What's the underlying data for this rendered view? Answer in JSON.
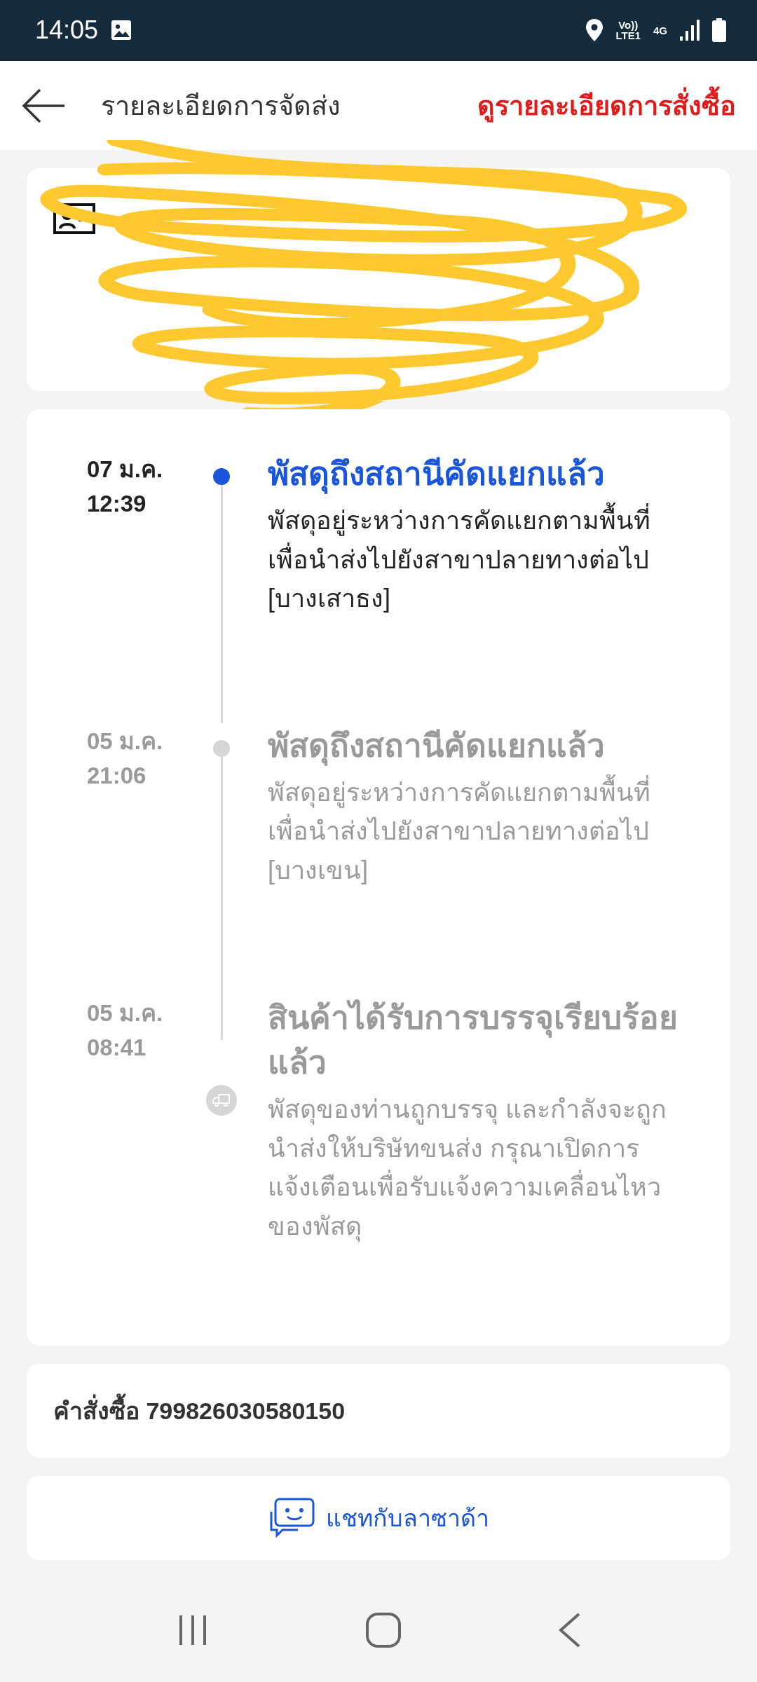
{
  "status_bar": {
    "time": "14:05",
    "network_label": "Vo)) LTE1",
    "network_type": "4G"
  },
  "header": {
    "title": "รายละเอียดการจัดส่ง",
    "action": "ดูรายละเอียดการสั่งซื้อ"
  },
  "address_card": {
    "hidden_by_scribble": true
  },
  "timeline": [
    {
      "date": "07 ม.ค.",
      "time": "12:39",
      "title": "พัสดุถึงสถานีคัดแยกแล้ว",
      "body": "พัสดุอยู่ระหว่างการคัดแยกตามพื้นที่เพื่อนำส่งไปยังสาขาปลายทางต่อไป [บางเสาธง]",
      "active": true,
      "kind": "dot"
    },
    {
      "date": "05 ม.ค.",
      "time": "21:06",
      "title": "พัสดุถึงสถานีคัดแยกแล้ว",
      "body": "พัสดุอยู่ระหว่างการคัดแยกตามพื้นที่เพื่อนำส่งไปยังสาขาปลายทางต่อไป [บางเขน]",
      "active": false,
      "kind": "dot"
    },
    {
      "date": "05 ม.ค.",
      "time": "08:41",
      "title": "สินค้าได้รับการบรรจุเรียบร้อยแล้ว",
      "body": "พัสดุของท่านถูกบรรจุ และกำลังจะถูกนำส่งให้บริษัทขนส่ง กรุณาเปิดการแจ้งเตือนเพื่อรับแจ้งความเคลื่อนไหวของพัสดุ",
      "active": false,
      "kind": "truck"
    }
  ],
  "order": {
    "label": "คำสั่งซื้อ 799826030580150"
  },
  "chat_button": {
    "label": "แชทกับลาซาด้า"
  }
}
